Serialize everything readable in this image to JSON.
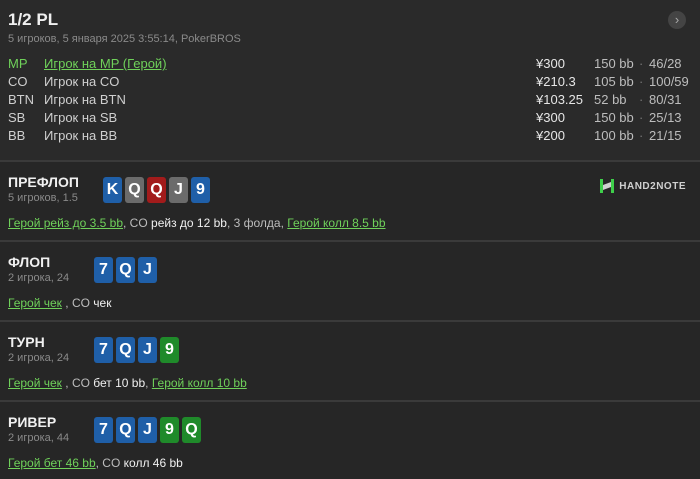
{
  "header": {
    "title": "1/2 PL",
    "subtitle": "5 игроков, 5 января 2025 3:55:14, PokerBROS",
    "nav_icon": "chevron-right-icon"
  },
  "players": [
    {
      "pos": "MP",
      "name": "Игрок на MP (Герой)",
      "amount": "¥300",
      "bb": "150 bb",
      "stat": "46/28",
      "hero": true
    },
    {
      "pos": "CO",
      "name": "Игрок на CO",
      "amount": "¥210.3",
      "bb": "105 bb",
      "stat": "100/59",
      "hero": false
    },
    {
      "pos": "BTN",
      "name": "Игрок на BTN",
      "amount": "¥103.25",
      "bb": "52 bb",
      "stat": "80/31",
      "hero": false
    },
    {
      "pos": "SB",
      "name": "Игрок на SB",
      "amount": "¥300",
      "bb": "150 bb",
      "stat": "25/13",
      "hero": false
    },
    {
      "pos": "BB",
      "name": "Игрок на BB",
      "amount": "¥200",
      "bb": "100 bb",
      "stat": "21/15",
      "hero": false
    }
  ],
  "stat_separator": "·",
  "logo": {
    "text": "HAND2NOTE",
    "accent": "#3ecf4a"
  },
  "card_colors": {
    "blue": "#1f5fa8",
    "gray": "#6b6b6b",
    "red": "#a21b1b",
    "green": "#1f8a2a"
  },
  "streets": {
    "preflop": {
      "name": "ПРЕФЛОП",
      "info": "5 игроков, 1.5",
      "cards": [
        {
          "rank": "K",
          "color": "blue"
        },
        {
          "rank": "Q",
          "color": "gray"
        },
        {
          "rank": "Q",
          "color": "red"
        },
        {
          "rank": "J",
          "color": "gray"
        },
        {
          "rank": "9",
          "color": "blue"
        }
      ],
      "actions": {
        "a1": "Герой рейз до 3.5 bb",
        "s1": ", CO ",
        "a2": "рейз до 12 bb",
        "s2": ", 3 фолда, ",
        "a3": "Герой колл 8.5 bb"
      }
    },
    "flop": {
      "name": "ФЛОП",
      "info": "2 игрока, 24",
      "cards": [
        {
          "rank": "7",
          "color": "blue"
        },
        {
          "rank": "Q",
          "color": "blue"
        },
        {
          "rank": "J",
          "color": "blue"
        }
      ],
      "actions": {
        "a1": "Герой чек",
        "s1": " , CO ",
        "a2": "чек"
      }
    },
    "turn": {
      "name": "ТУРН",
      "info": "2 игрока, 24",
      "cards": [
        {
          "rank": "7",
          "color": "blue"
        },
        {
          "rank": "Q",
          "color": "blue"
        },
        {
          "rank": "J",
          "color": "blue"
        },
        {
          "rank": "9",
          "color": "green"
        }
      ],
      "actions": {
        "a1": "Герой чек",
        "s1": " , CO ",
        "a2": "бет 10 bb",
        "s2": ", ",
        "a3": "Герой колл 10 bb"
      }
    },
    "river": {
      "name": "РИВЕР",
      "info": "2 игрока, 44",
      "cards": [
        {
          "rank": "7",
          "color": "blue"
        },
        {
          "rank": "Q",
          "color": "blue"
        },
        {
          "rank": "J",
          "color": "blue"
        },
        {
          "rank": "9",
          "color": "green"
        },
        {
          "rank": "Q",
          "color": "green"
        }
      ],
      "actions": {
        "a1": "Герой бет 46 bb",
        "s1": ", CO ",
        "a2": "колл 46 bb"
      }
    }
  }
}
